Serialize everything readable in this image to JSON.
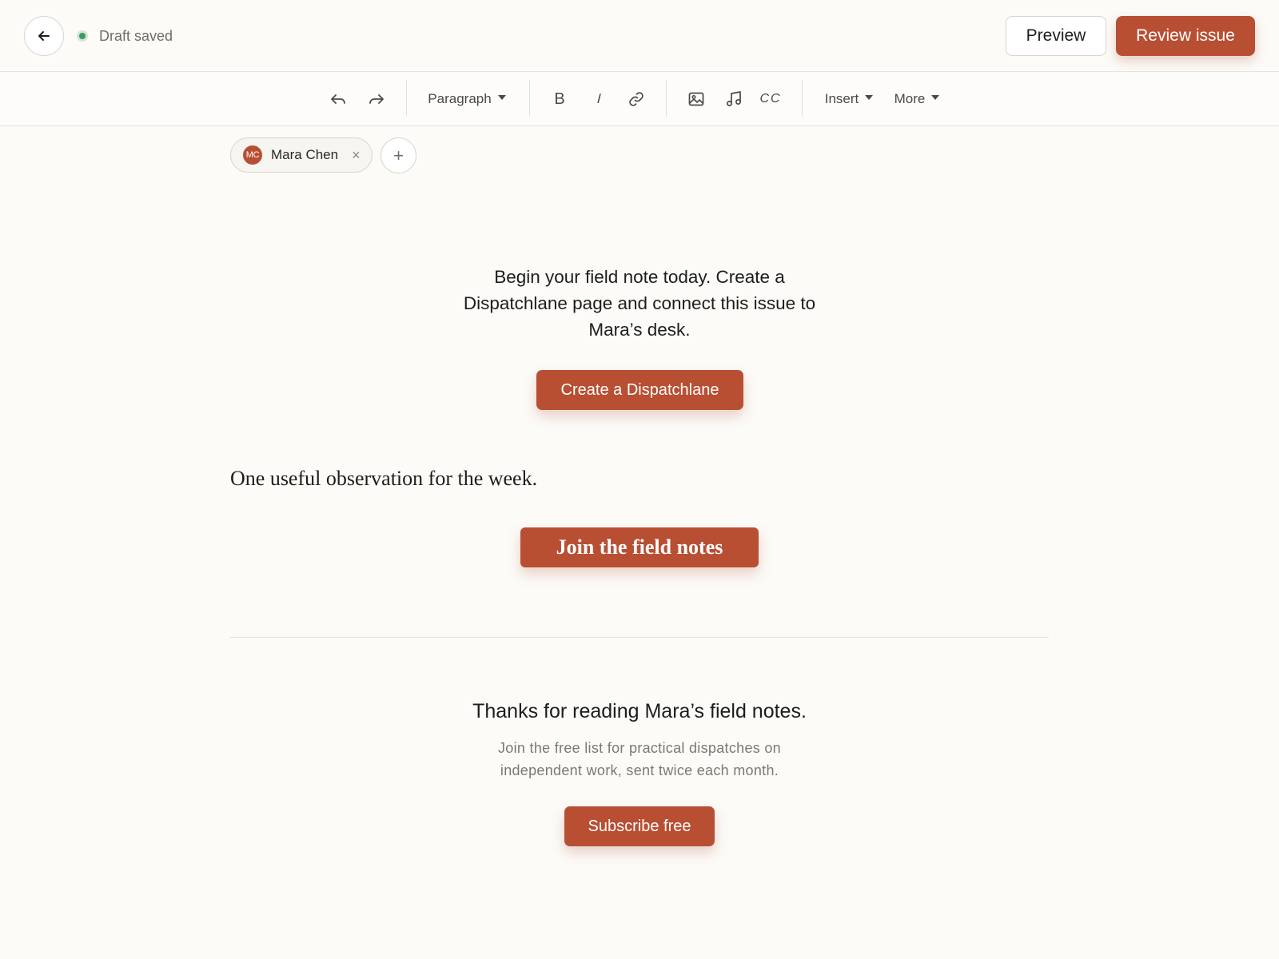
{
  "topbar": {
    "back_icon": "arrow-left-icon",
    "status_text": "Draft saved",
    "status_color": "#3f9a62",
    "preview_label": "Preview",
    "review_label": "Review issue"
  },
  "toolbar": {
    "undo_icon": "undo-icon",
    "redo_icon": "redo-icon",
    "block_style": "Paragraph",
    "bold_label": "B",
    "italic_label": "I",
    "link_icon": "link-icon",
    "image_icon": "image-icon",
    "audio_icon": "music-note-icon",
    "captions_label": "CC",
    "insert_label": "Insert",
    "more_label": "More"
  },
  "author": {
    "initials": "MC",
    "name": "Mara Chen",
    "remove_label": "×",
    "add_label": "+"
  },
  "embed": {
    "text": "Begin your field note today. Create a Dispatchlane page and connect this issue to Mara’s desk.",
    "button_label": "Create a Dispatchlane"
  },
  "content": {
    "paragraph": "One useful observation for the week.",
    "cta_label": "Join the field notes"
  },
  "footer": {
    "title": "Thanks for reading Mara’s field notes.",
    "subtitle": "Join the free list for practical dispatches on independent work, sent twice each month.",
    "subscribe_label": "Subscribe free"
  },
  "colors": {
    "accent": "#b84f33",
    "background": "#fcfbf8"
  }
}
